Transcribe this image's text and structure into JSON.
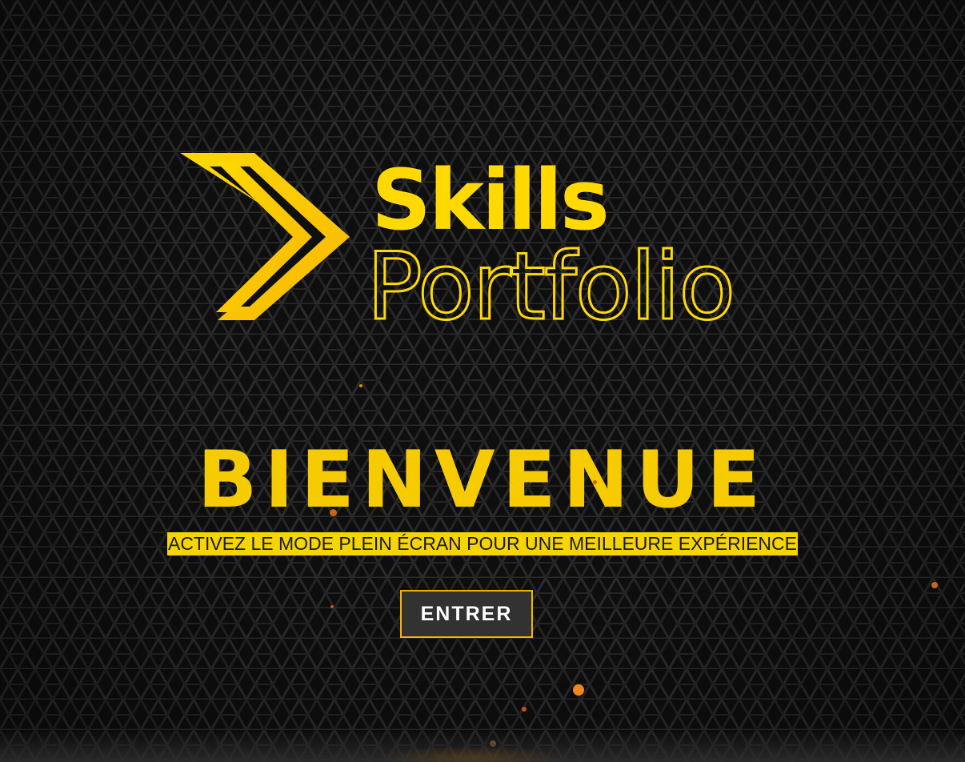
{
  "logo": {
    "word_top": "Skills",
    "word_bottom": "Portfolio"
  },
  "welcome": {
    "title": "BIENVENUE",
    "hint": "ACTIVEZ LE MODE PLEIN ÉCRAN POUR UNE MEILLEURE EXPÉRIENCE"
  },
  "actions": {
    "enter_label": "ENTRER"
  },
  "colors": {
    "accent": "#f6cc00",
    "hint_bg": "#f6d400",
    "button_border": "#f2b400",
    "button_bg": "#323232",
    "background": "#0d0d0d",
    "particle": "#e0781a"
  }
}
